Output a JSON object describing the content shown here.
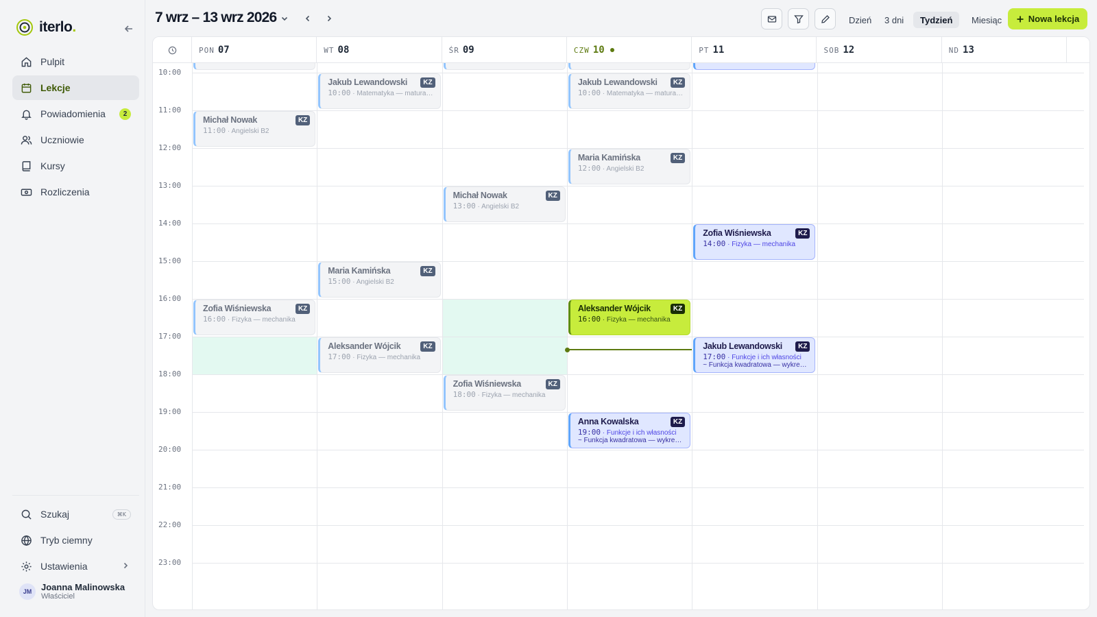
{
  "app": {
    "logo": "iterlo",
    "logo_dot": "."
  },
  "sidebar": {
    "items": [
      {
        "label": "Pulpit",
        "icon": "home-icon"
      },
      {
        "label": "Lekcje",
        "icon": "calendar-icon",
        "active": true
      },
      {
        "label": "Powiadomienia",
        "icon": "bell-icon",
        "badge": "2"
      },
      {
        "label": "Uczniowie",
        "icon": "users-icon"
      },
      {
        "label": "Kursy",
        "icon": "book-icon"
      },
      {
        "label": "Rozliczenia",
        "icon": "banknote-icon"
      }
    ],
    "bottom": {
      "search": "Szukaj",
      "search_kbd": "⌘K",
      "dark_mode": "Tryb ciemny",
      "settings": "Ustawienia"
    },
    "user": {
      "initials": "JM",
      "name": "Joanna Malinowska",
      "role": "Właściciel"
    }
  },
  "header": {
    "range": "7 wrz – 13 wrz 2026",
    "views": [
      "Dzień",
      "3 dni",
      "Tydzień",
      "Miesiąc"
    ],
    "active_view": "Tydzień",
    "new_button": "Nowa lekcja"
  },
  "calendar": {
    "days": [
      {
        "name": "PON",
        "num": "07"
      },
      {
        "name": "WT",
        "num": "08"
      },
      {
        "name": "ŚR",
        "num": "09"
      },
      {
        "name": "CZW",
        "num": "10",
        "today": true
      },
      {
        "name": "PT",
        "num": "11"
      },
      {
        "name": "SOB",
        "num": "12"
      },
      {
        "name": "ND",
        "num": "13"
      }
    ],
    "hours": [
      "10:00",
      "11:00",
      "12:00",
      "13:00",
      "14:00",
      "15:00",
      "16:00",
      "17:00",
      "18:00",
      "19:00",
      "20:00",
      "21:00",
      "22:00",
      "23:00"
    ],
    "badge": "KZ",
    "lessons": [
      {
        "day": 1,
        "start": "10:00",
        "name": "Jakub Lewandowski",
        "time": "10:00",
        "subject": "Matematyka — matura rozszerzona",
        "state": "past"
      },
      {
        "day": 3,
        "start": "10:00",
        "name": "Jakub Lewandowski",
        "time": "10:00",
        "subject": "Matematyka — matura rozszerzona",
        "state": "past"
      },
      {
        "day": 0,
        "start": "11:00",
        "name": "Michał Nowak",
        "time": "11:00",
        "subject": "Angielski B2",
        "state": "past"
      },
      {
        "day": 3,
        "start": "12:00",
        "name": "Maria Kamińska",
        "time": "12:00",
        "subject": "Angielski B2",
        "state": "past"
      },
      {
        "day": 2,
        "start": "13:00",
        "name": "Michał Nowak",
        "time": "13:00",
        "subject": "Angielski B2",
        "state": "past"
      },
      {
        "day": 4,
        "start": "14:00",
        "name": "Zofia Wiśniewska",
        "time": "14:00",
        "subject": "Fizyka — mechanika",
        "state": "future"
      },
      {
        "day": 1,
        "start": "15:00",
        "name": "Maria Kamińska",
        "time": "15:00",
        "subject": "Angielski B2",
        "state": "past"
      },
      {
        "day": 0,
        "start": "16:00",
        "name": "Zofia Wiśniewska",
        "time": "16:00",
        "subject": "Fizyka — mechanika",
        "state": "past"
      },
      {
        "day": 3,
        "start": "16:00",
        "name": "Aleksander Wójcik",
        "time": "16:00",
        "subject": "Fizyka — mechanika",
        "state": "current"
      },
      {
        "day": 1,
        "start": "17:00",
        "name": "Aleksander Wójcik",
        "time": "17:00",
        "subject": "Fizyka — mechanika",
        "state": "past"
      },
      {
        "day": 4,
        "start": "17:00",
        "name": "Jakub Lewandowski",
        "time": "17:00",
        "subject": "Funkcje i ich własności",
        "topic": "~ Funkcja kwadratowa — wykres i własności",
        "state": "future"
      },
      {
        "day": 2,
        "start": "18:00",
        "name": "Zofia Wiśniewska",
        "time": "18:00",
        "subject": "Fizyka — mechanika",
        "state": "past"
      },
      {
        "day": 3,
        "start": "19:00",
        "name": "Anna Kowalska",
        "time": "19:00",
        "subject": "Funkcje i ich własności",
        "topic": "~ Funkcja kwadratowa — wykres i własności",
        "state": "future"
      }
    ],
    "availability": [
      {
        "day": 0,
        "from": "17:00",
        "to": "18:00"
      },
      {
        "day": 2,
        "from": "16:00",
        "to": "18:00"
      }
    ],
    "now": {
      "day": 3,
      "time": "17:20",
      "to_day": 4
    },
    "peeks": [
      {
        "day": 0,
        "style": "past"
      },
      {
        "day": 2,
        "style": "past"
      },
      {
        "day": 3,
        "style": "past"
      },
      {
        "day": 4,
        "style": "future"
      }
    ]
  },
  "colors": {
    "accent": "#c7ec3c",
    "today": "#5d7a10",
    "available": "#e3f9f1",
    "future": "#e0e7ff"
  }
}
